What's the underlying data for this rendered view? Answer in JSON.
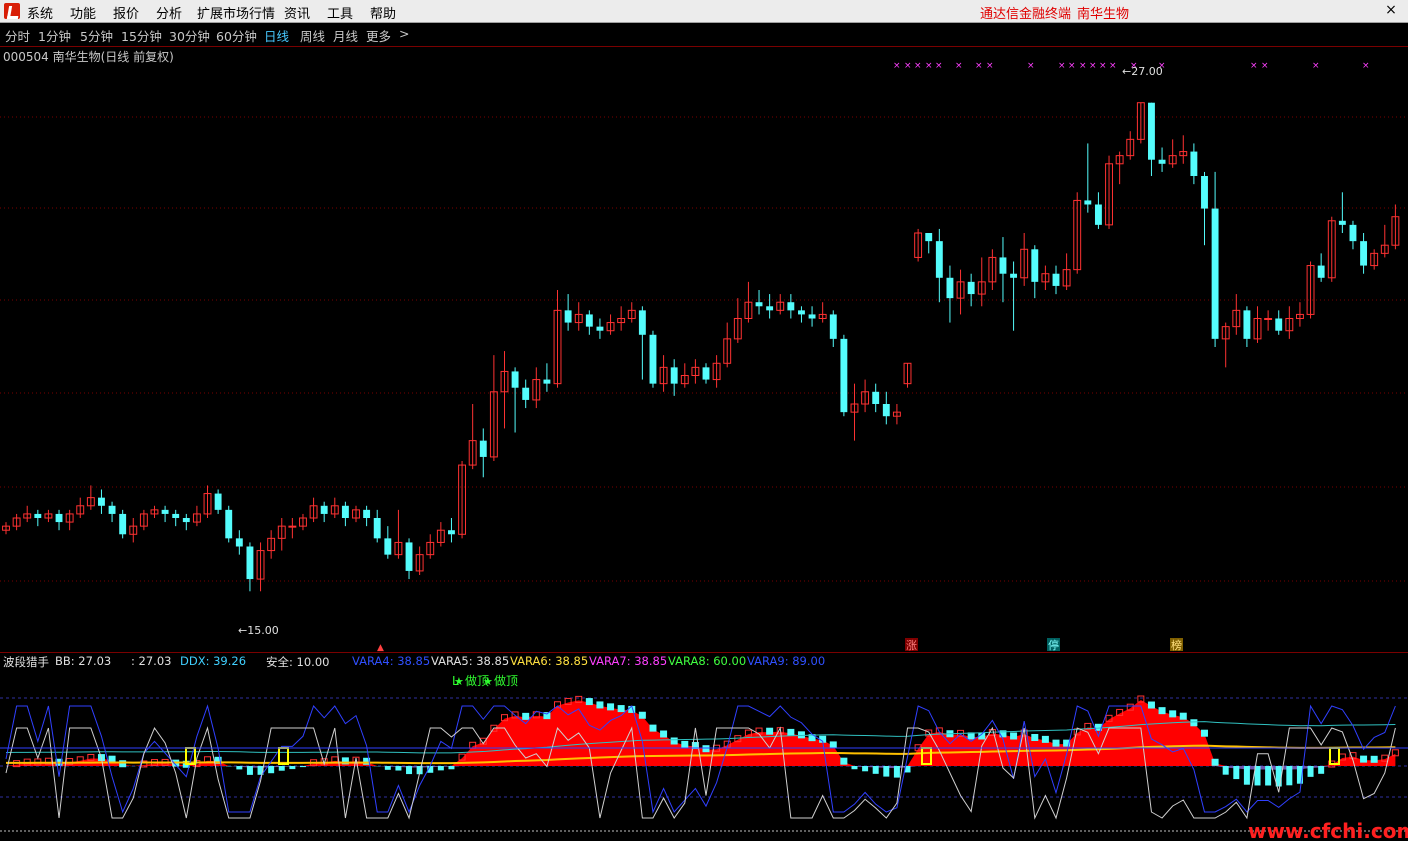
{
  "menu": {
    "items": [
      "系统",
      "功能",
      "报价",
      "分析",
      "扩展市场行情",
      "资讯",
      "工具",
      "帮助"
    ],
    "brand_app": "通达信金融终端",
    "brand_stock": "南华生物",
    "close": "×"
  },
  "periods": {
    "items": [
      "分时",
      "1分钟",
      "5分钟",
      "15分钟",
      "30分钟",
      "60分钟",
      "日线",
      "周线",
      "月线",
      "更多"
    ],
    "active": "日线",
    "more_arrow": ">"
  },
  "stock": {
    "title": "000504 南华生物(日线 前复权)",
    "high_marker": "←27.00",
    "low_marker": "←15.00",
    "tags": [
      "涨",
      "停",
      "榜"
    ]
  },
  "indicator": {
    "name": "波段猎手",
    "items": [
      {
        "label": "BB: 27.03",
        "color": "#e0e0e0"
      },
      {
        "label": ": 27.03",
        "color": "#e0e0e0"
      },
      {
        "label": "DDX: 39.26",
        "color": "#40d0ff"
      },
      {
        "label": "安全: 10.00",
        "color": "#e0e0e0"
      },
      {
        "label": "VARA4: 38.85",
        "color": "#3050ff"
      },
      {
        "label": "VARA5: 38.85",
        "color": "#e0e0e0"
      },
      {
        "label": "VARA6: 38.85",
        "color": "#ffe040"
      },
      {
        "label": "VARA7: 38.85",
        "color": "#ff40ff"
      },
      {
        "label": "VARA8: 60.00",
        "color": "#40ff40"
      },
      {
        "label": "VARA9: 89.00",
        "color": "#3050ff"
      }
    ],
    "signal": "做顶",
    "signal_letter": "L"
  },
  "watermark": "www.cfchi.com",
  "colors": {
    "up": "#ff3232",
    "down": "#54fcfc",
    "grid": "#7a0000",
    "fill_red": "#ff0000",
    "fill_purple": "#7a5cc0",
    "avg_line": "#ffc000",
    "yellow_box": "#ffff00"
  },
  "chart_data": {
    "type": "candlestick",
    "price_range": [
      14,
      28
    ],
    "high_label": 27.0,
    "low_label": 15.0,
    "candles": [
      [
        16.5,
        16.6,
        16.4,
        16.7
      ],
      [
        16.6,
        16.8,
        16.5,
        16.9
      ],
      [
        16.8,
        16.9,
        16.7,
        17.1
      ],
      [
        16.9,
        16.8,
        16.6,
        17.0
      ],
      [
        16.8,
        16.9,
        16.7,
        17.0
      ],
      [
        16.9,
        16.7,
        16.5,
        17.0
      ],
      [
        16.7,
        16.9,
        16.5,
        17.0
      ],
      [
        16.9,
        17.1,
        16.8,
        17.3
      ],
      [
        17.1,
        17.3,
        17.0,
        17.6
      ],
      [
        17.3,
        17.1,
        16.9,
        17.5
      ],
      [
        17.1,
        16.9,
        16.7,
        17.2
      ],
      [
        16.9,
        16.4,
        16.3,
        17.0
      ],
      [
        16.4,
        16.6,
        16.2,
        16.8
      ],
      [
        16.6,
        16.9,
        16.5,
        17.0
      ],
      [
        16.9,
        17.0,
        16.8,
        17.1
      ],
      [
        17.0,
        16.9,
        16.7,
        17.1
      ],
      [
        16.9,
        16.8,
        16.6,
        17.0
      ],
      [
        16.8,
        16.7,
        16.5,
        16.9
      ],
      [
        16.7,
        16.9,
        16.6,
        17.1
      ],
      [
        16.9,
        17.4,
        16.8,
        17.6
      ],
      [
        17.4,
        17.0,
        16.9,
        17.5
      ],
      [
        17.0,
        16.3,
        16.2,
        17.1
      ],
      [
        16.3,
        16.1,
        15.9,
        16.5
      ],
      [
        16.1,
        15.3,
        15.0,
        16.2
      ],
      [
        15.3,
        16.0,
        15.0,
        16.2
      ],
      [
        16.0,
        16.3,
        15.8,
        16.5
      ],
      [
        16.3,
        16.6,
        16.0,
        16.8
      ],
      [
        16.6,
        16.6,
        16.3,
        16.8
      ],
      [
        16.6,
        16.8,
        16.5,
        16.9
      ],
      [
        16.8,
        17.1,
        16.7,
        17.3
      ],
      [
        17.1,
        16.9,
        16.7,
        17.2
      ],
      [
        16.9,
        17.1,
        16.8,
        17.3
      ],
      [
        17.1,
        16.8,
        16.6,
        17.2
      ],
      [
        16.8,
        17.0,
        16.7,
        17.1
      ],
      [
        17.0,
        16.8,
        16.6,
        17.1
      ],
      [
        16.8,
        16.3,
        16.2,
        17.0
      ],
      [
        16.3,
        15.9,
        15.8,
        16.6
      ],
      [
        15.9,
        16.2,
        15.8,
        17.0
      ],
      [
        16.2,
        15.5,
        15.3,
        16.3
      ],
      [
        15.5,
        15.9,
        15.4,
        16.1
      ],
      [
        15.9,
        16.2,
        15.8,
        16.4
      ],
      [
        16.2,
        16.5,
        16.1,
        16.7
      ],
      [
        16.5,
        16.4,
        16.2,
        16.8
      ],
      [
        16.4,
        18.1,
        16.3,
        18.2
      ],
      [
        18.1,
        18.7,
        18.0,
        19.6
      ],
      [
        18.7,
        18.3,
        17.8,
        19.0
      ],
      [
        18.3,
        19.9,
        18.2,
        20.8
      ],
      [
        19.9,
        20.4,
        19.0,
        20.9
      ],
      [
        20.4,
        20.0,
        18.9,
        20.5
      ],
      [
        20.0,
        19.7,
        19.5,
        20.2
      ],
      [
        19.7,
        20.2,
        19.5,
        20.5
      ],
      [
        20.2,
        20.1,
        19.9,
        20.6
      ],
      [
        20.1,
        21.9,
        20.0,
        22.4
      ],
      [
        21.9,
        21.6,
        21.4,
        22.3
      ],
      [
        21.6,
        21.8,
        21.4,
        22.1
      ],
      [
        21.8,
        21.5,
        21.3,
        21.9
      ],
      [
        21.5,
        21.4,
        21.2,
        21.7
      ],
      [
        21.4,
        21.6,
        21.3,
        21.8
      ],
      [
        21.6,
        21.7,
        21.4,
        22.0
      ],
      [
        21.7,
        21.9,
        21.6,
        22.1
      ],
      [
        21.9,
        21.3,
        20.2,
        22.0
      ],
      [
        21.3,
        20.1,
        20.0,
        21.4
      ],
      [
        20.1,
        20.5,
        19.9,
        20.8
      ],
      [
        20.5,
        20.1,
        19.8,
        20.7
      ],
      [
        20.1,
        20.3,
        20.0,
        20.6
      ],
      [
        20.3,
        20.5,
        20.1,
        20.7
      ],
      [
        20.5,
        20.2,
        20.1,
        20.6
      ],
      [
        20.2,
        20.6,
        20.0,
        20.8
      ],
      [
        20.6,
        21.2,
        20.5,
        21.6
      ],
      [
        21.2,
        21.7,
        21.1,
        22.2
      ],
      [
        21.7,
        22.1,
        21.6,
        22.6
      ],
      [
        22.1,
        22.0,
        21.8,
        22.4
      ],
      [
        22.0,
        21.9,
        21.7,
        22.3
      ],
      [
        21.9,
        22.1,
        21.8,
        22.3
      ],
      [
        22.1,
        21.9,
        21.7,
        22.3
      ],
      [
        21.9,
        21.8,
        21.6,
        22.0
      ],
      [
        21.8,
        21.7,
        21.5,
        22.0
      ],
      [
        21.7,
        21.8,
        21.6,
        22.1
      ],
      [
        21.8,
        21.2,
        21.0,
        21.9
      ],
      [
        21.2,
        19.4,
        19.3,
        21.3
      ],
      [
        19.4,
        19.6,
        18.7,
        20.1
      ],
      [
        19.6,
        19.9,
        19.4,
        20.2
      ],
      [
        19.9,
        19.6,
        19.4,
        20.1
      ],
      [
        19.6,
        19.3,
        19.1,
        19.9
      ],
      [
        19.3,
        19.4,
        19.1,
        19.6
      ],
      [
        20.1,
        20.6,
        20.0,
        20.6
      ],
      [
        23.2,
        23.8,
        23.1,
        23.9
      ],
      [
        23.8,
        23.6,
        23.3,
        23.8
      ],
      [
        23.6,
        22.7,
        22.1,
        23.9
      ],
      [
        22.7,
        22.2,
        21.6,
        23.0
      ],
      [
        22.2,
        22.6,
        21.8,
        22.9
      ],
      [
        22.6,
        22.3,
        22.0,
        22.8
      ],
      [
        22.3,
        22.6,
        22.0,
        23.2
      ],
      [
        22.6,
        23.2,
        22.4,
        23.4
      ],
      [
        23.2,
        22.8,
        22.1,
        23.7
      ],
      [
        22.8,
        22.7,
        21.4,
        23.1
      ],
      [
        22.7,
        23.4,
        22.5,
        23.8
      ],
      [
        23.4,
        22.6,
        22.2,
        23.5
      ],
      [
        22.6,
        22.8,
        22.4,
        23.0
      ],
      [
        22.8,
        22.5,
        22.3,
        23.0
      ],
      [
        22.5,
        22.9,
        22.4,
        23.3
      ],
      [
        22.9,
        24.6,
        22.8,
        24.8
      ],
      [
        24.6,
        24.5,
        24.3,
        26.0
      ],
      [
        24.5,
        24.0,
        23.9,
        24.8
      ],
      [
        24.0,
        25.5,
        23.9,
        25.7
      ],
      [
        25.5,
        25.7,
        25.0,
        25.8
      ],
      [
        25.7,
        26.1,
        25.6,
        26.3
      ],
      [
        26.1,
        27.0,
        26.0,
        27.0
      ],
      [
        27.0,
        25.6,
        25.2,
        27.0
      ],
      [
        25.6,
        25.5,
        25.3,
        25.9
      ],
      [
        25.5,
        25.7,
        25.4,
        26.1
      ],
      [
        25.7,
        25.8,
        25.5,
        26.2
      ],
      [
        25.8,
        25.2,
        25.0,
        26.0
      ],
      [
        25.2,
        24.4,
        23.5,
        25.3
      ],
      [
        24.4,
        21.2,
        21.0,
        25.3
      ],
      [
        21.2,
        21.5,
        20.5,
        21.6
      ],
      [
        21.5,
        21.9,
        21.3,
        22.3
      ],
      [
        21.9,
        21.2,
        21.0,
        22.0
      ],
      [
        21.2,
        21.7,
        21.1,
        22.0
      ],
      [
        21.7,
        21.7,
        21.4,
        21.9
      ],
      [
        21.7,
        21.4,
        21.3,
        21.9
      ],
      [
        21.4,
        21.7,
        21.2,
        22.0
      ],
      [
        21.7,
        21.8,
        21.5,
        22.1
      ],
      [
        21.8,
        23.0,
        21.7,
        23.1
      ],
      [
        23.0,
        22.7,
        22.6,
        23.3
      ],
      [
        22.7,
        24.1,
        22.6,
        24.2
      ],
      [
        24.1,
        24.0,
        23.8,
        24.8
      ],
      [
        24.0,
        23.6,
        23.4,
        24.1
      ],
      [
        23.6,
        23.0,
        22.8,
        23.8
      ],
      [
        23.0,
        23.3,
        22.9,
        23.4
      ],
      [
        23.3,
        23.5,
        23.2,
        24.0
      ],
      [
        23.5,
        24.2,
        23.4,
        24.5
      ]
    ]
  }
}
